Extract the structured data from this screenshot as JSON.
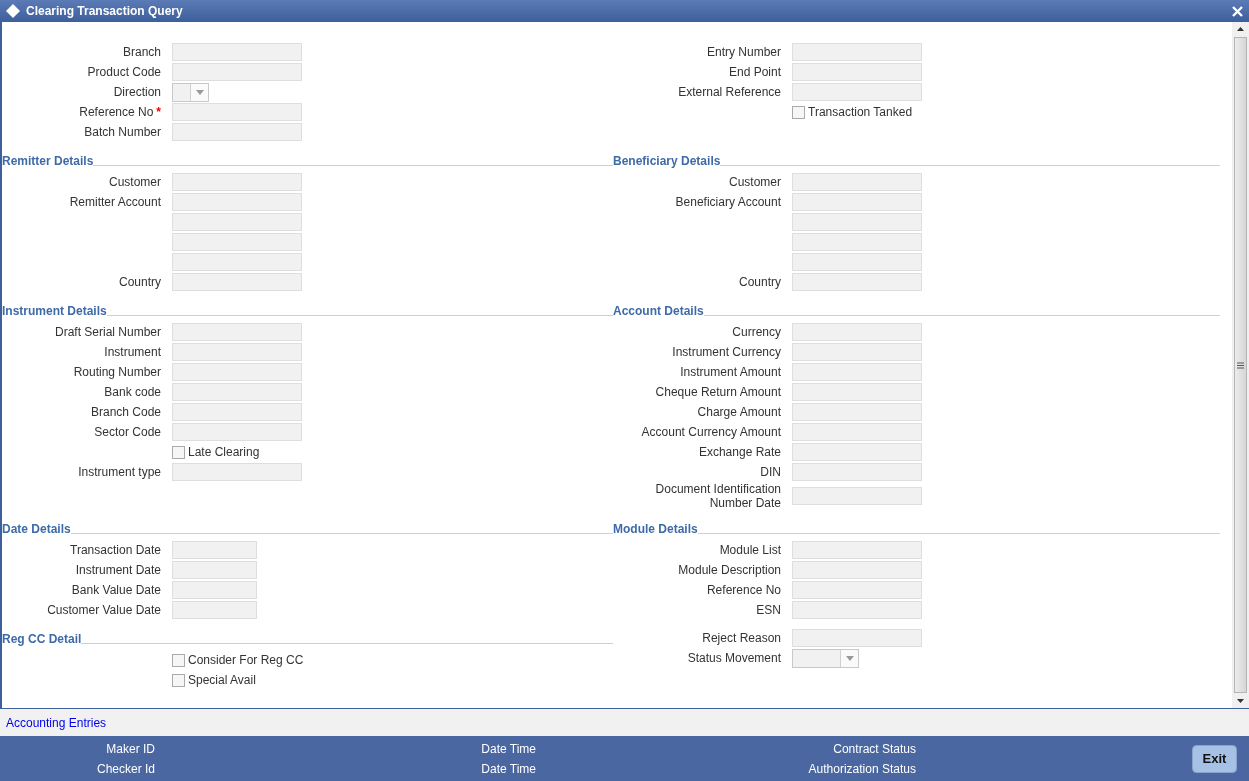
{
  "window": {
    "title": "Clearing Transaction Query"
  },
  "sections": [
    {
      "left": {
        "rows": [
          {
            "kind": "text",
            "label": "Branch"
          },
          {
            "kind": "text",
            "label": "Product Code"
          },
          {
            "kind": "select",
            "label": "Direction"
          },
          {
            "kind": "text",
            "label": "Reference No",
            "required_mark": "*"
          },
          {
            "kind": "text",
            "label": "Batch Number"
          }
        ]
      },
      "right": {
        "rows": [
          {
            "kind": "text",
            "label": "Entry Number"
          },
          {
            "kind": "text",
            "label": "End Point"
          },
          {
            "kind": "text",
            "label": "External Reference"
          },
          {
            "kind": "checkbox",
            "label": "Transaction Tanked",
            "checked": false
          }
        ]
      }
    },
    {
      "left": {
        "title": "Remitter Details",
        "rows": [
          {
            "kind": "text",
            "label": "Customer"
          },
          {
            "kind": "text",
            "label": "Remitter Account"
          },
          {
            "kind": "text"
          },
          {
            "kind": "text"
          },
          {
            "kind": "text"
          },
          {
            "kind": "text",
            "label": "Country"
          }
        ]
      },
      "right": {
        "title": "Beneficiary Details",
        "rows": [
          {
            "kind": "text",
            "label": "Customer"
          },
          {
            "kind": "text",
            "label": "Beneficiary Account"
          },
          {
            "kind": "text"
          },
          {
            "kind": "text"
          },
          {
            "kind": "text"
          },
          {
            "kind": "text",
            "label": "Country"
          }
        ]
      }
    },
    {
      "left": {
        "title": "Instrument Details",
        "rows": [
          {
            "kind": "text",
            "label": "Draft Serial Number"
          },
          {
            "kind": "text",
            "label": "Instrument"
          },
          {
            "kind": "text",
            "label": "Routing Number"
          },
          {
            "kind": "text",
            "label": "Bank code"
          },
          {
            "kind": "text",
            "label": "Branch Code"
          },
          {
            "kind": "text",
            "label": "Sector Code"
          },
          {
            "kind": "checkbox",
            "label": "Late Clearing",
            "checked": false
          },
          {
            "kind": "text",
            "label": "Instrument type"
          }
        ]
      },
      "right": {
        "title": "Account Details",
        "rows": [
          {
            "kind": "text",
            "label": "Currency"
          },
          {
            "kind": "text",
            "label": "Instrument Currency"
          },
          {
            "kind": "text",
            "label": "Instrument Amount"
          },
          {
            "kind": "text",
            "label": "Cheque Return Amount"
          },
          {
            "kind": "text",
            "label": "Charge Amount"
          },
          {
            "kind": "text",
            "label": "Account Currency Amount"
          },
          {
            "kind": "text",
            "label": "Exchange Rate"
          },
          {
            "kind": "text",
            "label": "DIN"
          },
          {
            "kind": "text",
            "label": "Document Identification Number Date"
          }
        ]
      }
    },
    {
      "left": {
        "title": "Date Details",
        "rows": [
          {
            "kind": "date",
            "label": "Transaction Date"
          },
          {
            "kind": "date",
            "label": "Instrument Date"
          },
          {
            "kind": "date",
            "label": "Bank Value Date"
          },
          {
            "kind": "date",
            "label": "Customer Value Date"
          }
        ]
      },
      "right": {
        "title": "Module Details",
        "rows": [
          {
            "kind": "text",
            "label": "Module List"
          },
          {
            "kind": "text",
            "label": "Module Description"
          },
          {
            "kind": "text",
            "label": "Reference No"
          },
          {
            "kind": "text",
            "label": "ESN"
          }
        ]
      }
    },
    {
      "left": {
        "title": "Reg CC Detail",
        "rows": [
          {
            "kind": "checkbox",
            "label": "Consider For Reg CC",
            "checked": false
          },
          {
            "kind": "checkbox",
            "label": "Special Avail",
            "checked": false
          }
        ]
      },
      "right": {
        "rows": [
          {
            "kind": "text",
            "label": "Reject Reason"
          },
          {
            "kind": "combo",
            "label": "Status Movement"
          }
        ]
      }
    }
  ],
  "accounting_link": "Accounting Entries",
  "footer": {
    "columns": [
      [
        "Maker ID",
        "Checker Id"
      ],
      [
        "Date Time",
        "Date Time"
      ],
      [
        "Contract Status",
        "Authorization Status"
      ]
    ],
    "exit_button": "Exit"
  }
}
